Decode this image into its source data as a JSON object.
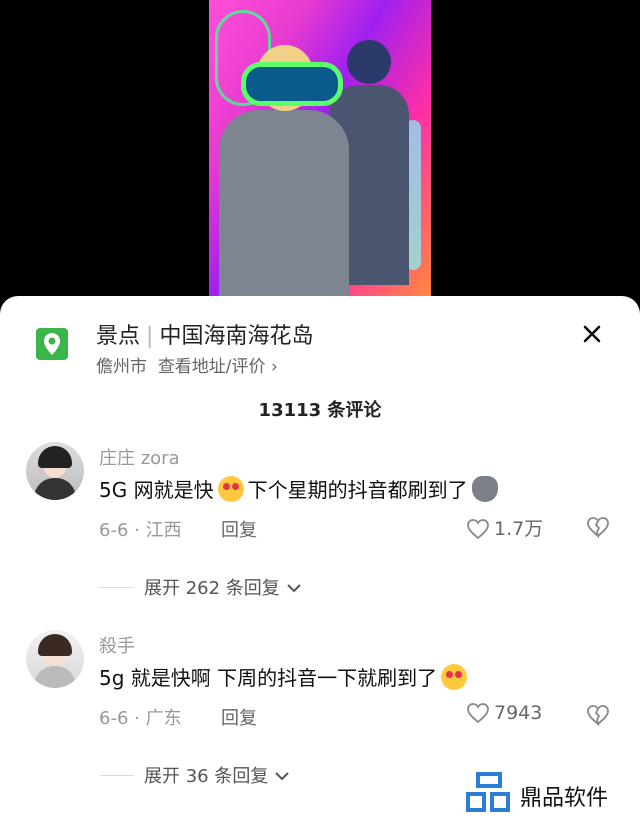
{
  "location": {
    "category": "景点",
    "place": "中国海南海花岛",
    "city": "儋州市",
    "link": "查看地址/评价",
    "icon": "location-pin-icon"
  },
  "comments_count": "13113 条评论",
  "comments": [
    {
      "username": "庄庄 zora",
      "text_a": "5G 网就是快",
      "text_b": "下个星期的抖音都刷到了",
      "date_location": "6-6 · 江西",
      "reply_label": "回复",
      "likes": "1.7万",
      "expand_label": "展开 262 条回复"
    },
    {
      "username": "殺手",
      "text_a": "5g 就是快啊 下周的抖音一下就刷到了",
      "date_location": "6-6 · 广东",
      "reply_label": "回复",
      "likes": "7943",
      "expand_label": "展开 36 条回复"
    }
  ],
  "watermark": {
    "text": "鼎品软件"
  },
  "colors": {
    "pin": "#39b54a",
    "accent_text": "#111111",
    "muted": "#999999"
  }
}
